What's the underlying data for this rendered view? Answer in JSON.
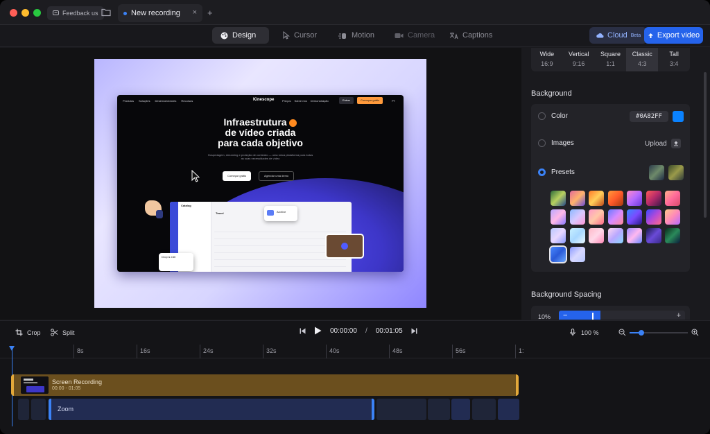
{
  "titlebar": {
    "feedback_label": "Feedback us",
    "tab_title": "New recording",
    "close_glyph": "×",
    "add_tab_glyph": "+"
  },
  "toolbar": {
    "modes": [
      {
        "label": "Design",
        "icon": "palette-icon",
        "state": "active"
      },
      {
        "label": "Cursor",
        "icon": "cursor-icon",
        "state": "normal"
      },
      {
        "label": "Motion",
        "icon": "motion-icon",
        "state": "normal"
      },
      {
        "label": "Camera",
        "icon": "camera-icon",
        "state": "disabled"
      },
      {
        "label": "Captions",
        "icon": "translate-icon",
        "state": "normal"
      }
    ],
    "cloud_label": "Cloud",
    "cloud_badge": "Beta",
    "export_label": "Export video",
    "accent": "#2563eb"
  },
  "preview": {
    "nav_links": [
      "Produtos",
      "Soluções",
      "Desenvolvedores",
      "Recursos"
    ],
    "brand": "Kinescope",
    "nav_right": [
      "Preços",
      "Sobre nós",
      "Demonstração"
    ],
    "login": "Entrar",
    "cta": "Começar grátis",
    "lang": "PT",
    "hero_line1": "Infraestrutura",
    "hero_line2": "de vídeo criada",
    "hero_line3": "para cada objetivo",
    "hero_sub": "Hospedagem, streaming e proteção de conteúdo — uma única plataforma para todas as suas necessidades de vídeo",
    "hero_btn_primary": "Começar grátis",
    "hero_btn_secondary": "Agendar uma demo",
    "app_title": "Catalog",
    "app_section": "Travel",
    "archive_label": "Archive",
    "drag_label": "Drop & edit"
  },
  "panel": {
    "aspects": [
      {
        "name": "Wide",
        "ratio": "16:9",
        "active": false
      },
      {
        "name": "Vertical",
        "ratio": "9:16",
        "active": false
      },
      {
        "name": "Square",
        "ratio": "1:1",
        "active": false
      },
      {
        "name": "Classic",
        "ratio": "4:3",
        "active": true
      },
      {
        "name": "Tall",
        "ratio": "3:4",
        "active": false
      }
    ],
    "background_title": "Background",
    "color_label": "Color",
    "color_hex": "#0A82FF",
    "images_label": "Images",
    "upload_label": "Upload",
    "presets_label": "Presets",
    "spacing_title": "Background Spacing",
    "spacing_value": "10%",
    "spacing_minus": "−",
    "spacing_plus": "+",
    "spacing_fraction": 0.1,
    "selected_preset_index": 21
  },
  "timeline": {
    "crop_label": "Crop",
    "split_label": "Split",
    "current_time": "00:00:00",
    "separator": "/",
    "total_time": "00:01:05",
    "volume": "100 %",
    "zoom_fraction": 0.2,
    "ruler": [
      "8s",
      "16s",
      "24s",
      "32s",
      "40s",
      "48s",
      "56s",
      "1:"
    ],
    "clip_title": "Screen Recording",
    "clip_range": "00:00 - 01:05",
    "zoom_label": "Zoom"
  }
}
